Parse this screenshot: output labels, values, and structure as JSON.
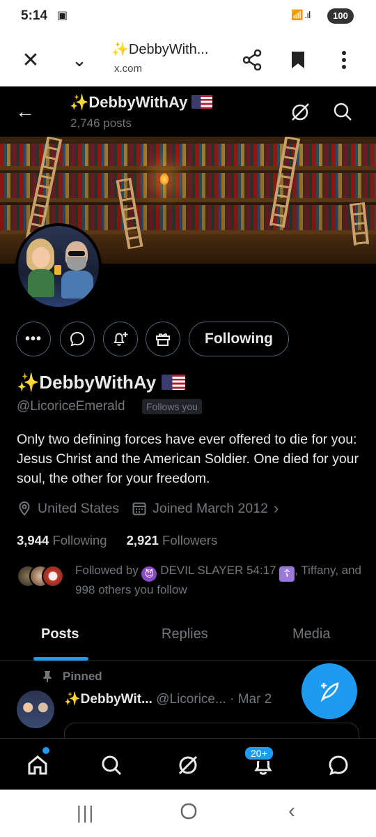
{
  "status_bar": {
    "time": "5:14",
    "battery": "100"
  },
  "browser": {
    "title": "✨DebbyWith...",
    "url": "x.com"
  },
  "header": {
    "name": "DebbyWithAy",
    "posts_count": "2,746 posts"
  },
  "profile": {
    "display_name": "DebbyWithAy",
    "handle": "@LicoriceEmerald",
    "follows_you": "Follows you",
    "bio": "Only two defining forces have ever offered to die for you: Jesus Christ and the American Soldier. One died for your soul, the other for your freedom.",
    "location": "United States",
    "joined": "Joined March 2012",
    "following_count": "3,944",
    "following_label": "Following",
    "followers_count": "2,921",
    "followers_label": "Followers",
    "following_button": "Following",
    "followed_by_prefix": "Followed by",
    "followed_by_name1": "DEVIL SLAYER 54:17",
    "followed_by_rest": ", Tiffany, and 998 others you follow"
  },
  "tabs": [
    {
      "label": "Posts",
      "active": true
    },
    {
      "label": "Replies",
      "active": false
    },
    {
      "label": "Media",
      "active": false
    }
  ],
  "pinned_post": {
    "pinned_label": "Pinned",
    "author": "DebbyWit...",
    "handle": "@Licorice...",
    "date": "· Mar 2"
  },
  "bottom_nav": {
    "notifications_badge": "20+"
  },
  "colors": {
    "accent": "#1d9bf0",
    "background": "#000000",
    "muted": "#71767b"
  }
}
